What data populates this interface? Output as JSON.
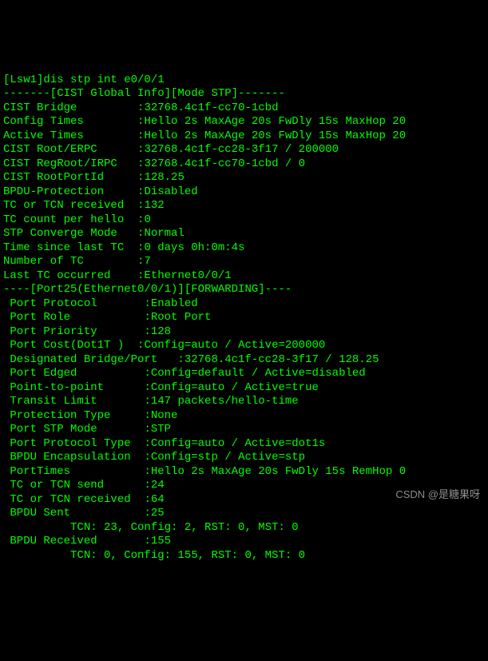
{
  "prompt": "[Lsw1]dis stp int e0/0/1",
  "globalHeader": "-------[CIST Global Info][Mode STP]-------",
  "global": {
    "cistBridge": {
      "label": "CIST Bridge",
      "value": ":32768.4c1f-cc70-1cbd"
    },
    "configTimes": {
      "label": "Config Times",
      "value": ":Hello 2s MaxAge 20s FwDly 15s MaxHop 20"
    },
    "activeTimes": {
      "label": "Active Times",
      "value": ":Hello 2s MaxAge 20s FwDly 15s MaxHop 20"
    },
    "cistRootErpc": {
      "label": "CIST Root/ERPC",
      "value": ":32768.4c1f-cc28-3f17 / 200000"
    },
    "cistRegRootIrpc": {
      "label": "CIST RegRoot/IRPC",
      "value": ":32768.4c1f-cc70-1cbd / 0"
    },
    "cistRootPortId": {
      "label": "CIST RootPortId",
      "value": ":128.25"
    },
    "bpduProtection": {
      "label": "BPDU-Protection",
      "value": ":Disabled"
    },
    "tcOrTcnReceived": {
      "label": "TC or TCN received",
      "value": ":132"
    },
    "tcCountPerHello": {
      "label": "TC count per hello",
      "value": ":0"
    },
    "stpConvergeMode": {
      "label": "STP Converge Mode",
      "value": ":Normal"
    },
    "timeSinceLastTc": {
      "label": "Time since last TC",
      "value": ":0 days 0h:0m:4s"
    },
    "numberOfTc": {
      "label": "Number of TC",
      "value": ":7"
    },
    "lastTcOccurred": {
      "label": "Last TC occurred",
      "value": ":Ethernet0/0/1"
    }
  },
  "portHeader": "----[Port25(Ethernet0/0/1)][FORWARDING]----",
  "port": {
    "portProtocol": {
      "label": " Port Protocol",
      "value": ":Enabled"
    },
    "portRole": {
      "label": " Port Role",
      "value": ":Root Port"
    },
    "portPriority": {
      "label": " Port Priority",
      "value": ":128"
    },
    "portCost": {
      "label": " Port Cost(Dot1T )",
      "value": ":Config=auto / Active=200000"
    },
    "designated": {
      "full": " Designated Bridge/Port   :32768.4c1f-cc28-3f17 / 128.25"
    },
    "portEdged": {
      "label": " Port Edged",
      "value": ":Config=default / Active=disabled"
    },
    "pointToPoint": {
      "label": " Point-to-point",
      "value": ":Config=auto / Active=true"
    },
    "transitLimit": {
      "label": " Transit Limit",
      "value": ":147 packets/hello-time"
    },
    "protectionType": {
      "label": " Protection Type",
      "value": ":None"
    },
    "portStpMode": {
      "label": " Port STP Mode",
      "value": ":STP"
    },
    "portProtocolType": {
      "label": " Port Protocol Type",
      "value": ":Config=auto / Active=dot1s"
    },
    "bpduEncapsulation": {
      "label": " BPDU Encapsulation",
      "value": ":Config=stp / Active=stp"
    },
    "portTimes": {
      "label": " PortTimes",
      "value": ":Hello 2s MaxAge 20s FwDly 15s RemHop 0"
    },
    "tcOrTcnSend": {
      "label": " TC or TCN send",
      "value": ":24"
    },
    "tcOrTcnReceived": {
      "label": " TC or TCN received",
      "value": ":64"
    },
    "bpduSent": {
      "label": " BPDU Sent",
      "value": ":25"
    },
    "bpduSentDetail": "          TCN: 23, Config: 2, RST: 0, MST: 0",
    "bpduReceived": {
      "label": " BPDU Received",
      "value": ":155"
    },
    "bpduReceivedDetail": "          TCN: 0, Config: 155, RST: 0, MST: 0"
  },
  "watermark": "CSDN @是糖果呀"
}
